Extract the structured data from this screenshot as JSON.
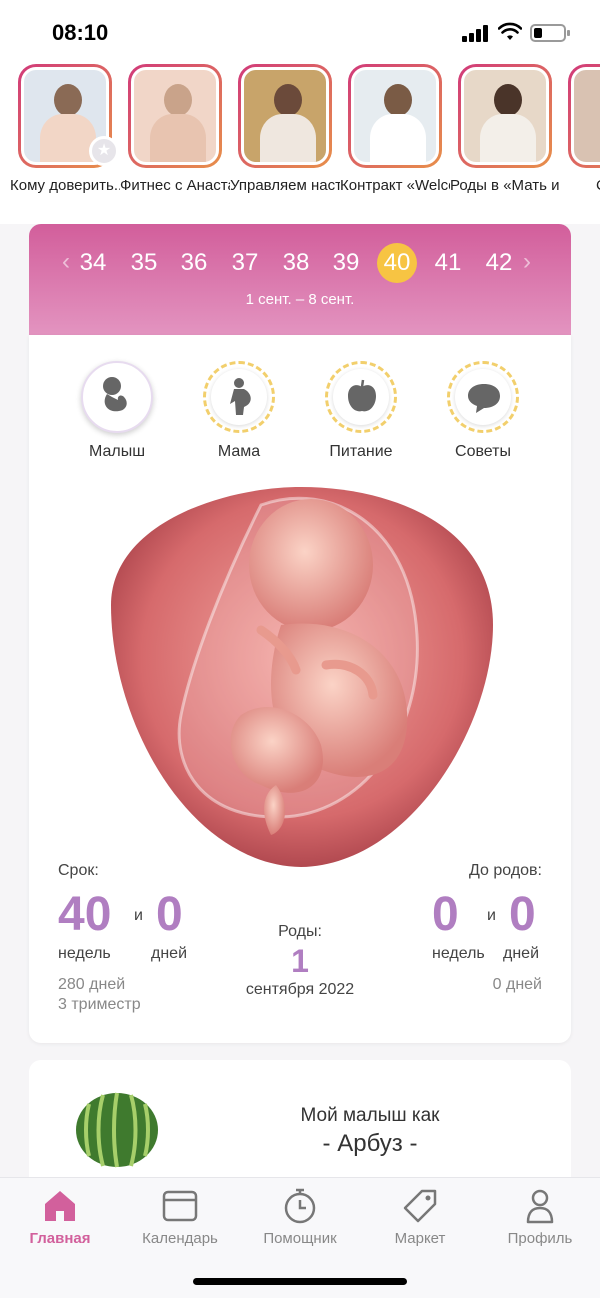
{
  "status": {
    "time": "08:10"
  },
  "stories": [
    {
      "caption": "Кому доверить...",
      "hair": "#8a6a55",
      "bg": "#dfe6ee"
    },
    {
      "caption": "Фитнес с Анастасие...",
      "hair": "#c9a38a",
      "bg": "#f1d6c8"
    },
    {
      "caption": "Управляем настроени...",
      "hair": "#6b4a3a",
      "bg": "#c8a46a"
    },
    {
      "caption": "Контракт «Welcome...",
      "hair": "#7a5b45",
      "bg": "#e6ecf0"
    },
    {
      "caption": "Роды в «Мать и Д...",
      "hair": "#4a3429",
      "bg": "#e7d8c8"
    },
    {
      "caption": "С",
      "hair": "#5a3d30",
      "bg": "#d9c2b2"
    }
  ],
  "weeks": {
    "list": [
      "34",
      "35",
      "36",
      "37",
      "38",
      "39",
      "40",
      "41",
      "42"
    ],
    "selected": "40",
    "range": "1 сент. – 8 сент."
  },
  "categories": [
    {
      "label": "Малыш",
      "icon": "baby-icon"
    },
    {
      "label": "Мама",
      "icon": "pregnant-woman-icon"
    },
    {
      "label": "Питание",
      "icon": "apple-icon"
    },
    {
      "label": "Советы",
      "icon": "chat-bubble-icon"
    }
  ],
  "term": {
    "label": "Срок:",
    "weeks": "40",
    "and": "и",
    "days": "0",
    "weeks_unit": "недель",
    "days_unit": "дней",
    "total_days": "280 дней",
    "trimester": "3 триместр"
  },
  "birth": {
    "label": "Роды:",
    "day": "1",
    "month_year": "сентября 2022"
  },
  "remaining": {
    "label": "До родов:",
    "weeks": "0",
    "and": "и",
    "days": "0",
    "weeks_unit": "недель",
    "days_unit": "дней",
    "total_days": "0 дней"
  },
  "fruit": {
    "title": "Мой малыш как",
    "name": "- Арбуз -"
  },
  "tabs": [
    {
      "label": "Главная",
      "icon": "home-icon",
      "active": true
    },
    {
      "label": "Календарь",
      "icon": "calendar-icon"
    },
    {
      "label": "Помощник",
      "icon": "stopwatch-icon"
    },
    {
      "label": "Маркет",
      "icon": "tag-icon"
    },
    {
      "label": "Профиль",
      "icon": "profile-icon"
    }
  ],
  "colors": {
    "accent": "#d2609c",
    "selected_week": "#f7c443",
    "numbers": "#b07ec1"
  }
}
